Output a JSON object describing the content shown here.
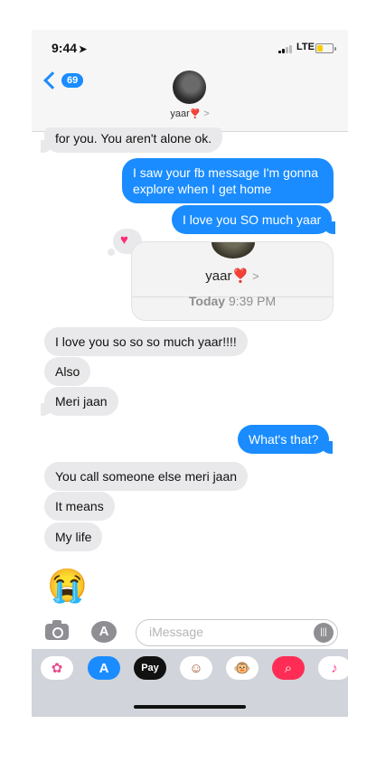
{
  "status": {
    "time": "9:44",
    "network": "LTE"
  },
  "header": {
    "back_count": "69",
    "contact_name": "yaar",
    "contact_heart": "❣️",
    "chevron": ">"
  },
  "messages": [
    {
      "side": "received",
      "text": "for you. You aren't alone ok."
    },
    {
      "side": "sent",
      "text": "I saw your fb message I'm gonna"
    },
    {
      "side": "sent",
      "text": "explore when I get home"
    },
    {
      "side": "sent",
      "text": "I love you SO much yaar"
    },
    {
      "side": "received",
      "text": "I love you so so so much yaar!!!!"
    },
    {
      "side": "received",
      "text": "Also"
    },
    {
      "side": "received",
      "text": "Meri jaan"
    },
    {
      "side": "sent",
      "text": "What's that?"
    },
    {
      "side": "received",
      "text": "You call someone else meri jaan"
    },
    {
      "side": "received",
      "text": "It means"
    },
    {
      "side": "received",
      "text": "My life"
    },
    {
      "side": "received",
      "text": "😭"
    }
  ],
  "shared_card": {
    "name": "yaar",
    "heart": "❣️",
    "chevron": ">",
    "date_day": "Today",
    "date_time": "9:39 PM"
  },
  "tapback": {
    "icon": "heart-icon",
    "glyph": "♥"
  },
  "input": {
    "placeholder": "iMessage"
  },
  "app_strip": [
    {
      "name": "photos-app-icon",
      "glyph": "✿"
    },
    {
      "name": "app-store-icon",
      "glyph": "A"
    },
    {
      "name": "apple-pay-icon",
      "glyph": "Pay"
    },
    {
      "name": "memoji-icon",
      "glyph": "☺"
    },
    {
      "name": "animoji-monkey-icon",
      "glyph": "🐵"
    },
    {
      "name": "search-images-icon",
      "glyph": "⌕"
    },
    {
      "name": "music-icon",
      "glyph": "♪"
    }
  ],
  "colors": {
    "sent": "#1a8cff",
    "received": "#e9e9eb",
    "heart": "#ff2d77"
  }
}
